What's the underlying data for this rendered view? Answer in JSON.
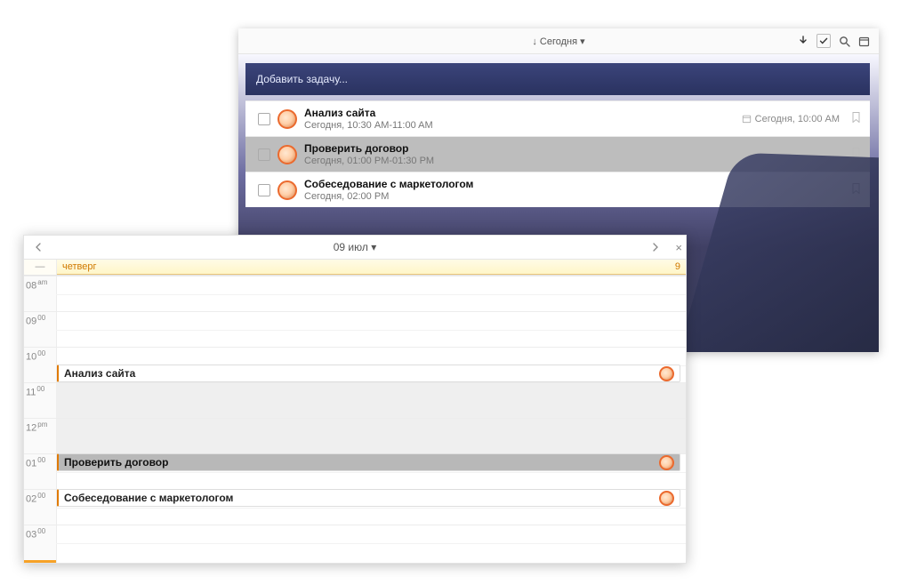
{
  "colors": {
    "accent": "#eb6a2e",
    "accent2": "#e07a00"
  },
  "taskWindow": {
    "toolbar": {
      "sortPrefix": "↓",
      "sort_label": "Сегодня",
      "dropdown_glyph": "▾",
      "icons": {
        "download": "↓",
        "checked": "✓",
        "search": "🔍",
        "calendar": "▭"
      }
    },
    "add_placeholder": "Добавить задачу...",
    "tasks": [
      {
        "title": "Анализ сайта",
        "subtitle": "Сегодня, 10:30 AM-11:00 AM",
        "due": "Сегодня, 10:00 AM",
        "selected": false
      },
      {
        "title": "Проверить договор",
        "subtitle": "Сегодня, 01:00 PM-01:30 PM",
        "due": "",
        "selected": true
      },
      {
        "title": "Собеседование с маркетологом",
        "subtitle": "Сегодня, 02:00 PM",
        "due": "",
        "selected": false
      }
    ]
  },
  "calendarWindow": {
    "title": "09 июл",
    "dropdown_glyph": "▾",
    "day_name": "четверг",
    "day_num": "9",
    "gutter_collapse": "—",
    "hours": [
      {
        "label": "08",
        "suffix": "am",
        "grey": false
      },
      {
        "label": "09",
        "suffix": "00",
        "grey": false
      },
      {
        "label": "10",
        "suffix": "00",
        "grey": false
      },
      {
        "label": "11",
        "suffix": "00",
        "grey": true
      },
      {
        "label": "12",
        "suffix": "pm",
        "grey": true
      },
      {
        "label": "01",
        "suffix": "00",
        "grey": false
      },
      {
        "label": "02",
        "suffix": "00",
        "grey": false
      },
      {
        "label": "03",
        "suffix": "00",
        "grey": false
      }
    ],
    "events": [
      {
        "title": "Анализ сайта",
        "hourIndex": 2,
        "startHalf": 1,
        "halves": 1,
        "selected": false
      },
      {
        "title": "Проверить договор",
        "hourIndex": 5,
        "startHalf": 0,
        "halves": 1,
        "selected": true
      },
      {
        "title": "Собеседование с маркетологом",
        "hourIndex": 6,
        "startHalf": 0,
        "halves": 1,
        "selected": false
      }
    ]
  }
}
